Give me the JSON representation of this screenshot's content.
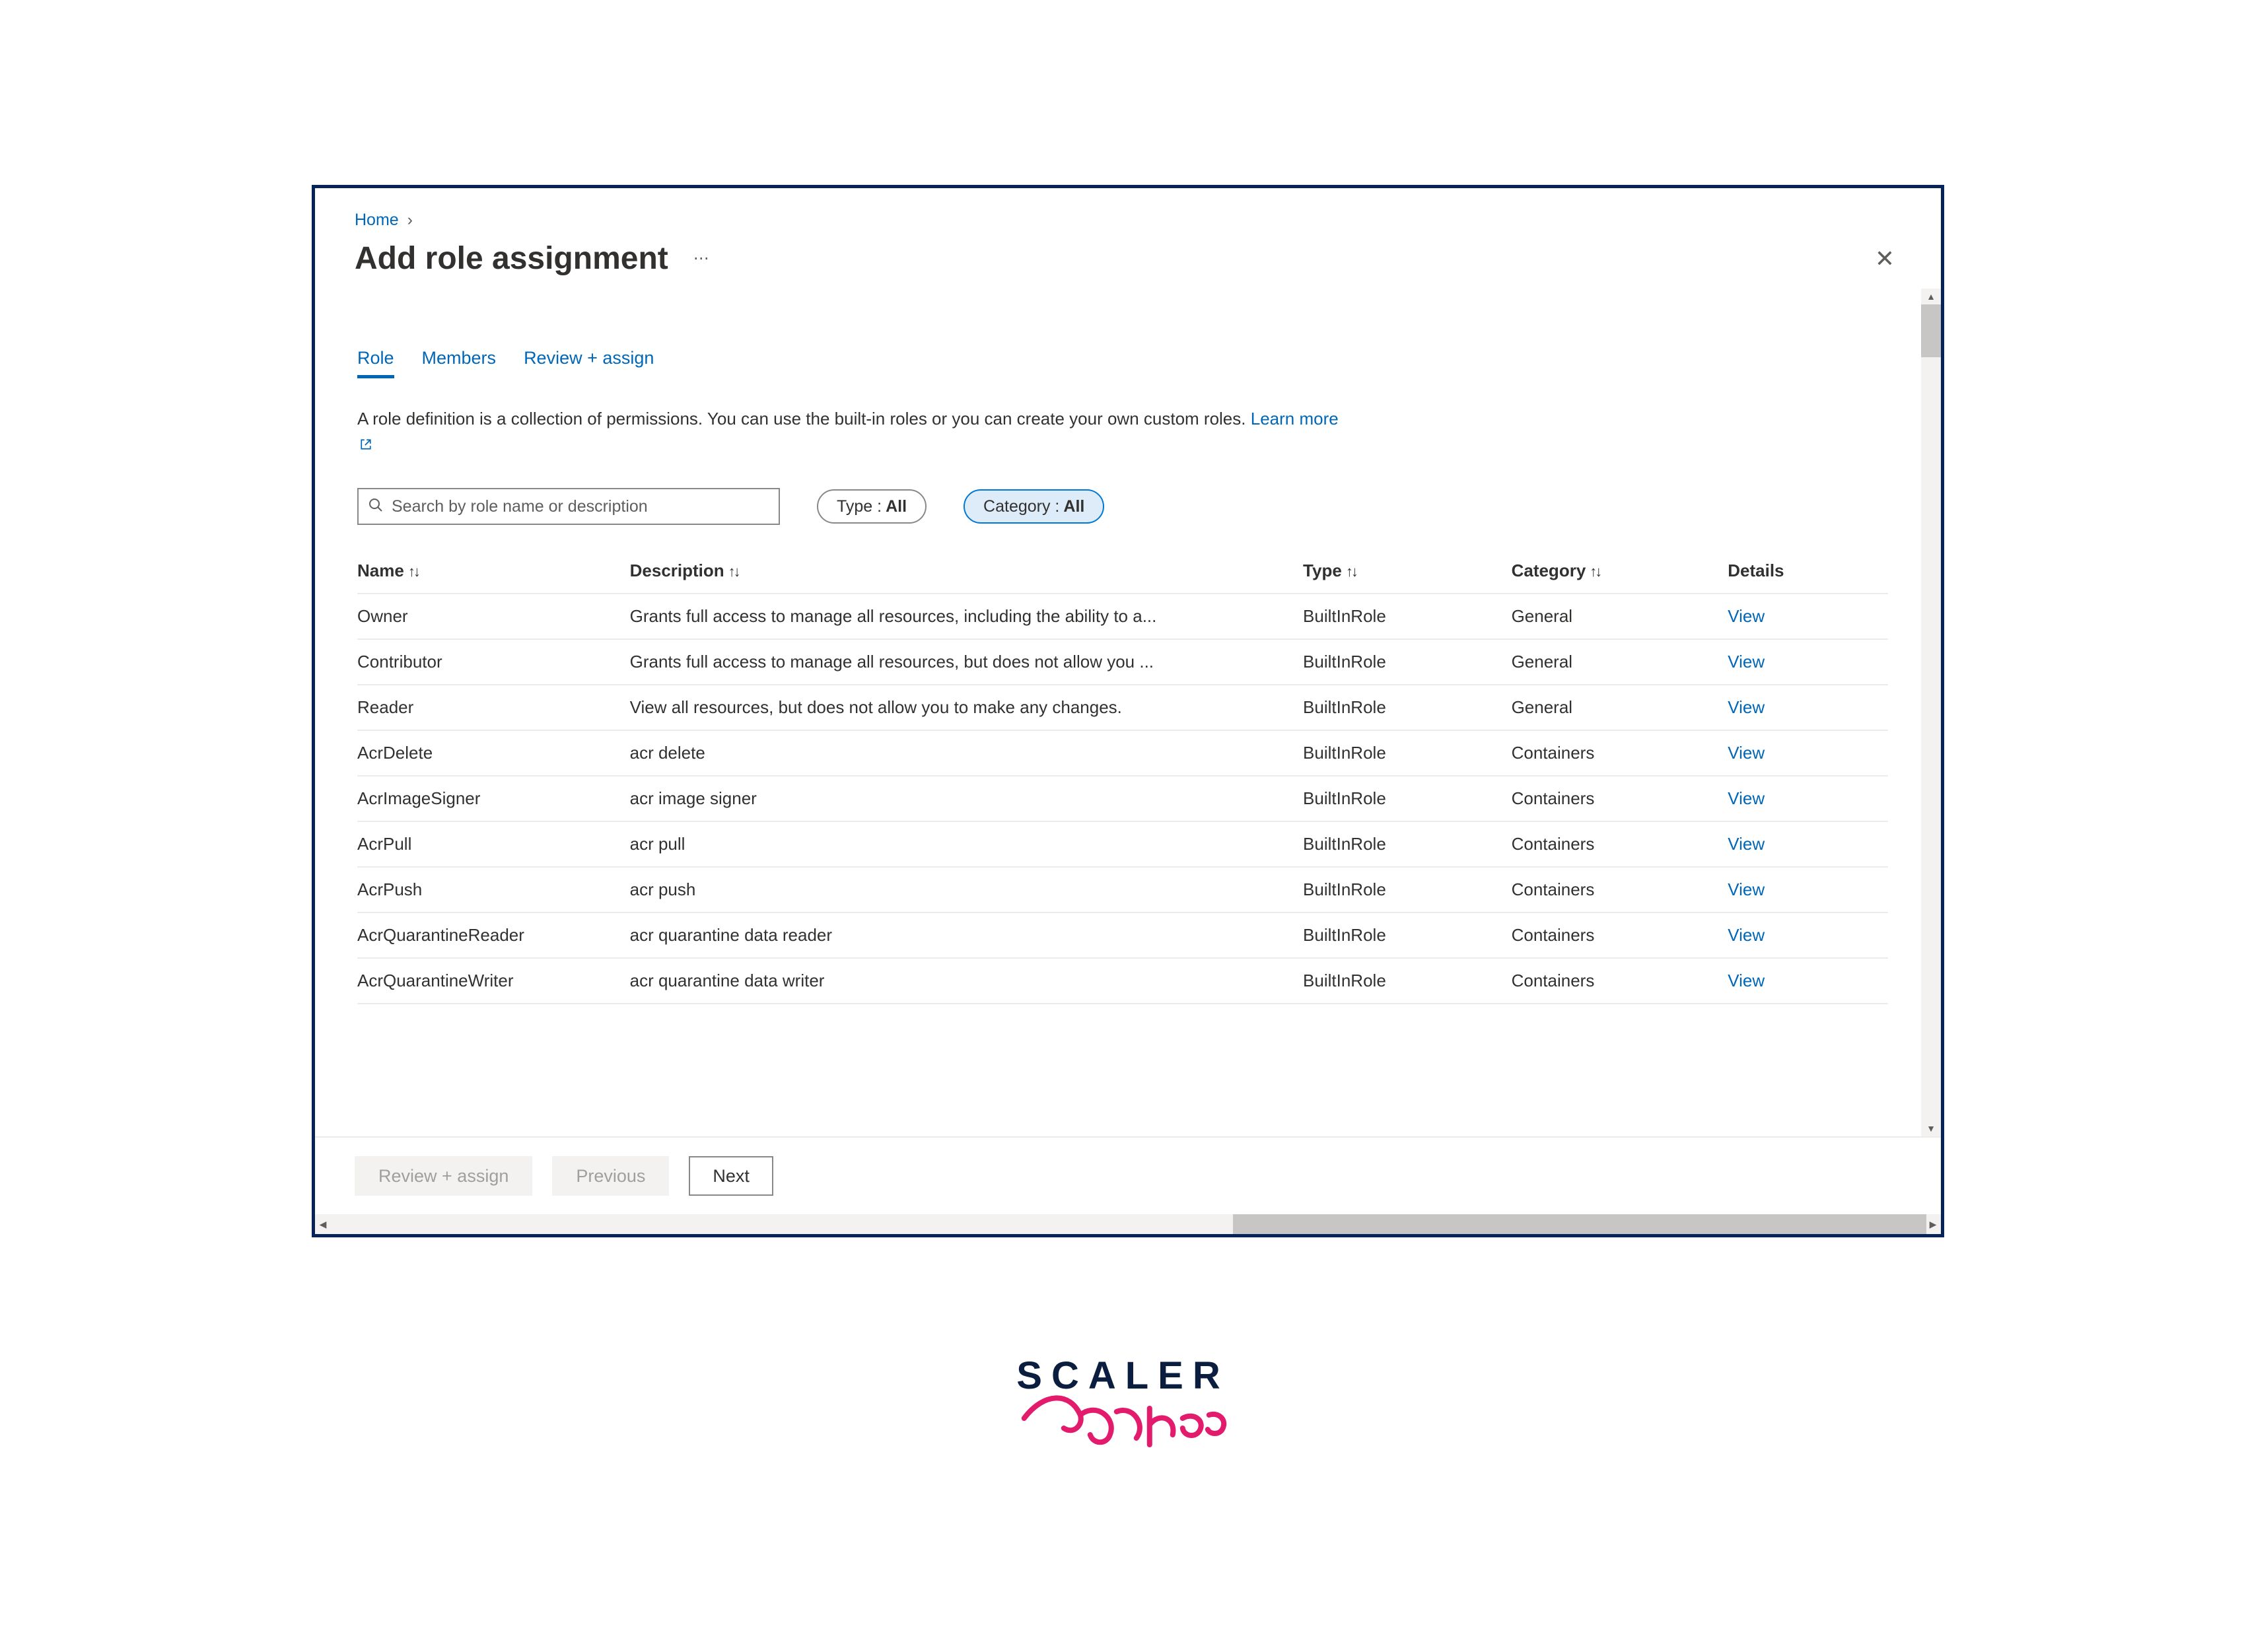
{
  "breadcrumb": {
    "home": "Home"
  },
  "header": {
    "title": "Add role assignment"
  },
  "tabs": [
    {
      "label": "Role",
      "active": true
    },
    {
      "label": "Members",
      "active": false
    },
    {
      "label": "Review + assign",
      "active": false
    }
  ],
  "description": {
    "text": "A role definition is a collection of permissions. You can use the built-in roles or you can create your own custom roles.",
    "learn_more": "Learn more"
  },
  "filters": {
    "search_placeholder": "Search by role name or description",
    "type": {
      "label": "Type :",
      "value": "All"
    },
    "category": {
      "label": "Category :",
      "value": "All"
    }
  },
  "columns": {
    "name": "Name",
    "description": "Description",
    "type": "Type",
    "category": "Category",
    "details": "Details"
  },
  "details_link": "View",
  "roles": [
    {
      "name": "Owner",
      "description": "Grants full access to manage all resources, including the ability to a...",
      "type": "BuiltInRole",
      "category": "General"
    },
    {
      "name": "Contributor",
      "description": "Grants full access to manage all resources, but does not allow you ...",
      "type": "BuiltInRole",
      "category": "General"
    },
    {
      "name": "Reader",
      "description": "View all resources, but does not allow you to make any changes.",
      "type": "BuiltInRole",
      "category": "General"
    },
    {
      "name": "AcrDelete",
      "description": "acr delete",
      "type": "BuiltInRole",
      "category": "Containers"
    },
    {
      "name": "AcrImageSigner",
      "description": "acr image signer",
      "type": "BuiltInRole",
      "category": "Containers"
    },
    {
      "name": "AcrPull",
      "description": "acr pull",
      "type": "BuiltInRole",
      "category": "Containers"
    },
    {
      "name": "AcrPush",
      "description": "acr push",
      "type": "BuiltInRole",
      "category": "Containers"
    },
    {
      "name": "AcrQuarantineReader",
      "description": "acr quarantine data reader",
      "type": "BuiltInRole",
      "category": "Containers"
    },
    {
      "name": "AcrQuarantineWriter",
      "description": "acr quarantine data writer",
      "type": "BuiltInRole",
      "category": "Containers"
    }
  ],
  "footer": {
    "review": "Review + assign",
    "previous": "Previous",
    "next": "Next"
  },
  "brand": {
    "line1": "SCALER",
    "line2": "Topics"
  }
}
